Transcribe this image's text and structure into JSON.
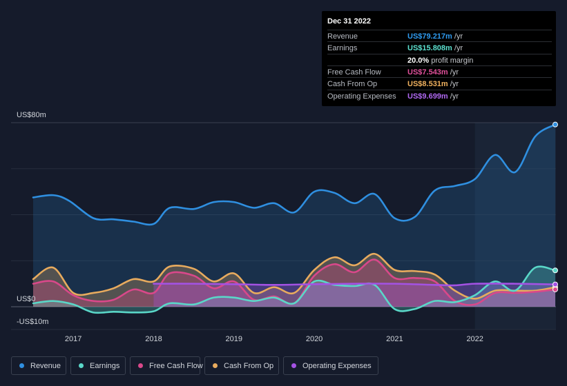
{
  "chart_data": {
    "type": "area",
    "x_ticks": [
      "2017",
      "2018",
      "2019",
      "2020",
      "2021",
      "2022"
    ],
    "y_labels": [
      "US$80m",
      "US$0",
      "-US$10m"
    ],
    "ylim": [
      -10,
      80
    ],
    "x_range": [
      2016.5,
      2023.0
    ],
    "forecast_start": 2022.0,
    "grid": true,
    "legend_position": "bottom-left",
    "series": [
      {
        "name": "Revenue",
        "color": "#2f8fe0",
        "points": [
          [
            2016.5,
            47.5
          ],
          [
            2016.75,
            48.5
          ],
          [
            2016.95,
            46
          ],
          [
            2017.25,
            38.5
          ],
          [
            2017.5,
            38
          ],
          [
            2017.75,
            37
          ],
          [
            2018.0,
            36
          ],
          [
            2018.2,
            43
          ],
          [
            2018.5,
            42.5
          ],
          [
            2018.75,
            45.5
          ],
          [
            2019.0,
            45.5
          ],
          [
            2019.25,
            43
          ],
          [
            2019.5,
            45
          ],
          [
            2019.75,
            41
          ],
          [
            2020.0,
            50
          ],
          [
            2020.25,
            49.5
          ],
          [
            2020.5,
            45
          ],
          [
            2020.75,
            49
          ],
          [
            2021.0,
            38.5
          ],
          [
            2021.25,
            39
          ],
          [
            2021.5,
            50.5
          ],
          [
            2021.75,
            52.5
          ],
          [
            2022.0,
            55.5
          ],
          [
            2022.25,
            66
          ],
          [
            2022.5,
            58.5
          ],
          [
            2022.75,
            74
          ],
          [
            2023.0,
            79.2
          ]
        ]
      },
      {
        "name": "Earnings",
        "color": "#5ad7c8",
        "points": [
          [
            2016.5,
            1.5
          ],
          [
            2016.75,
            2.5
          ],
          [
            2017.0,
            1
          ],
          [
            2017.25,
            -2.5
          ],
          [
            2017.5,
            -2.2
          ],
          [
            2017.75,
            -2.5
          ],
          [
            2018.0,
            -2
          ],
          [
            2018.2,
            1.5
          ],
          [
            2018.5,
            1
          ],
          [
            2018.75,
            4
          ],
          [
            2019.0,
            4
          ],
          [
            2019.25,
            2.5
          ],
          [
            2019.5,
            4
          ],
          [
            2019.75,
            1.5
          ],
          [
            2020.0,
            11
          ],
          [
            2020.25,
            9.5
          ],
          [
            2020.5,
            9
          ],
          [
            2020.75,
            9.5
          ],
          [
            2021.0,
            -1
          ],
          [
            2021.25,
            -1
          ],
          [
            2021.5,
            2.5
          ],
          [
            2021.75,
            2
          ],
          [
            2022.0,
            5
          ],
          [
            2022.25,
            11
          ],
          [
            2022.5,
            7
          ],
          [
            2022.75,
            17
          ],
          [
            2023.0,
            15.8
          ]
        ]
      },
      {
        "name": "Free Cash Flow",
        "color": "#d9488a",
        "points": [
          [
            2016.5,
            10
          ],
          [
            2016.75,
            11
          ],
          [
            2017.0,
            5
          ],
          [
            2017.25,
            2.5
          ],
          [
            2017.5,
            3
          ],
          [
            2017.75,
            7.5
          ],
          [
            2018.0,
            6
          ],
          [
            2018.2,
            14.5
          ],
          [
            2018.5,
            13.5
          ],
          [
            2018.75,
            8
          ],
          [
            2019.0,
            11
          ],
          [
            2019.25,
            3
          ],
          [
            2019.5,
            4.5
          ],
          [
            2019.75,
            1.5
          ],
          [
            2020.0,
            13.5
          ],
          [
            2020.25,
            18.5
          ],
          [
            2020.5,
            15
          ],
          [
            2020.75,
            20.5
          ],
          [
            2021.0,
            12.5
          ],
          [
            2021.25,
            12.5
          ],
          [
            2021.5,
            11
          ],
          [
            2021.75,
            2.5
          ],
          [
            2022.0,
            1
          ],
          [
            2022.25,
            6
          ],
          [
            2022.5,
            6
          ],
          [
            2022.75,
            6.5
          ],
          [
            2023.0,
            7.5
          ]
        ]
      },
      {
        "name": "Cash From Op",
        "color": "#e8ab5e",
        "points": [
          [
            2016.5,
            12
          ],
          [
            2016.75,
            17
          ],
          [
            2017.0,
            6
          ],
          [
            2017.25,
            6
          ],
          [
            2017.5,
            8
          ],
          [
            2017.75,
            12
          ],
          [
            2018.0,
            11
          ],
          [
            2018.2,
            17.5
          ],
          [
            2018.5,
            16.5
          ],
          [
            2018.75,
            11
          ],
          [
            2019.0,
            14.5
          ],
          [
            2019.25,
            6
          ],
          [
            2019.5,
            8.5
          ],
          [
            2019.75,
            6
          ],
          [
            2020.0,
            16
          ],
          [
            2020.25,
            21.5
          ],
          [
            2020.5,
            18
          ],
          [
            2020.75,
            23
          ],
          [
            2021.0,
            16
          ],
          [
            2021.25,
            15.5
          ],
          [
            2021.5,
            14
          ],
          [
            2021.75,
            7
          ],
          [
            2022.0,
            3.5
          ],
          [
            2022.25,
            7
          ],
          [
            2022.5,
            7
          ],
          [
            2022.75,
            7
          ],
          [
            2023.0,
            8.5
          ]
        ]
      },
      {
        "name": "Operating Expenses",
        "color": "#a452e4",
        "points": [
          [
            2018.0,
            10
          ],
          [
            2018.5,
            10
          ],
          [
            2019.0,
            9.8
          ],
          [
            2019.5,
            9.5
          ],
          [
            2020.0,
            9.8
          ],
          [
            2020.5,
            10
          ],
          [
            2021.0,
            10
          ],
          [
            2021.5,
            9.5
          ],
          [
            2021.75,
            9.3
          ],
          [
            2022.0,
            10
          ],
          [
            2022.5,
            10
          ],
          [
            2023.0,
            9.7
          ]
        ]
      }
    ]
  },
  "tooltip": {
    "date": "Dec 31 2022",
    "rows": [
      {
        "label": "Revenue",
        "value": "US$79.217m",
        "unit": " /yr",
        "color": "#2f9bf0"
      },
      {
        "label": "Earnings",
        "value": "US$15.808m",
        "unit": " /yr",
        "color": "#5ce0cf"
      },
      {
        "label": "",
        "value": "20.0%",
        "unit": " profit margin",
        "color": "#ffffff"
      },
      {
        "label": "Free Cash Flow",
        "value": "US$7.543m",
        "unit": " /yr",
        "color": "#e0509a"
      },
      {
        "label": "Cash From Op",
        "value": "US$8.531m",
        "unit": " /yr",
        "color": "#f0b15e"
      },
      {
        "label": "Operating Expenses",
        "value": "US$9.699m",
        "unit": " /yr",
        "color": "#b069f2"
      }
    ]
  },
  "legend": [
    {
      "label": "Revenue",
      "color": "#2f8fe0"
    },
    {
      "label": "Earnings",
      "color": "#5ad7c8"
    },
    {
      "label": "Free Cash Flow",
      "color": "#d9488a"
    },
    {
      "label": "Cash From Op",
      "color": "#e8ab5e"
    },
    {
      "label": "Operating Expenses",
      "color": "#a452e4"
    }
  ]
}
